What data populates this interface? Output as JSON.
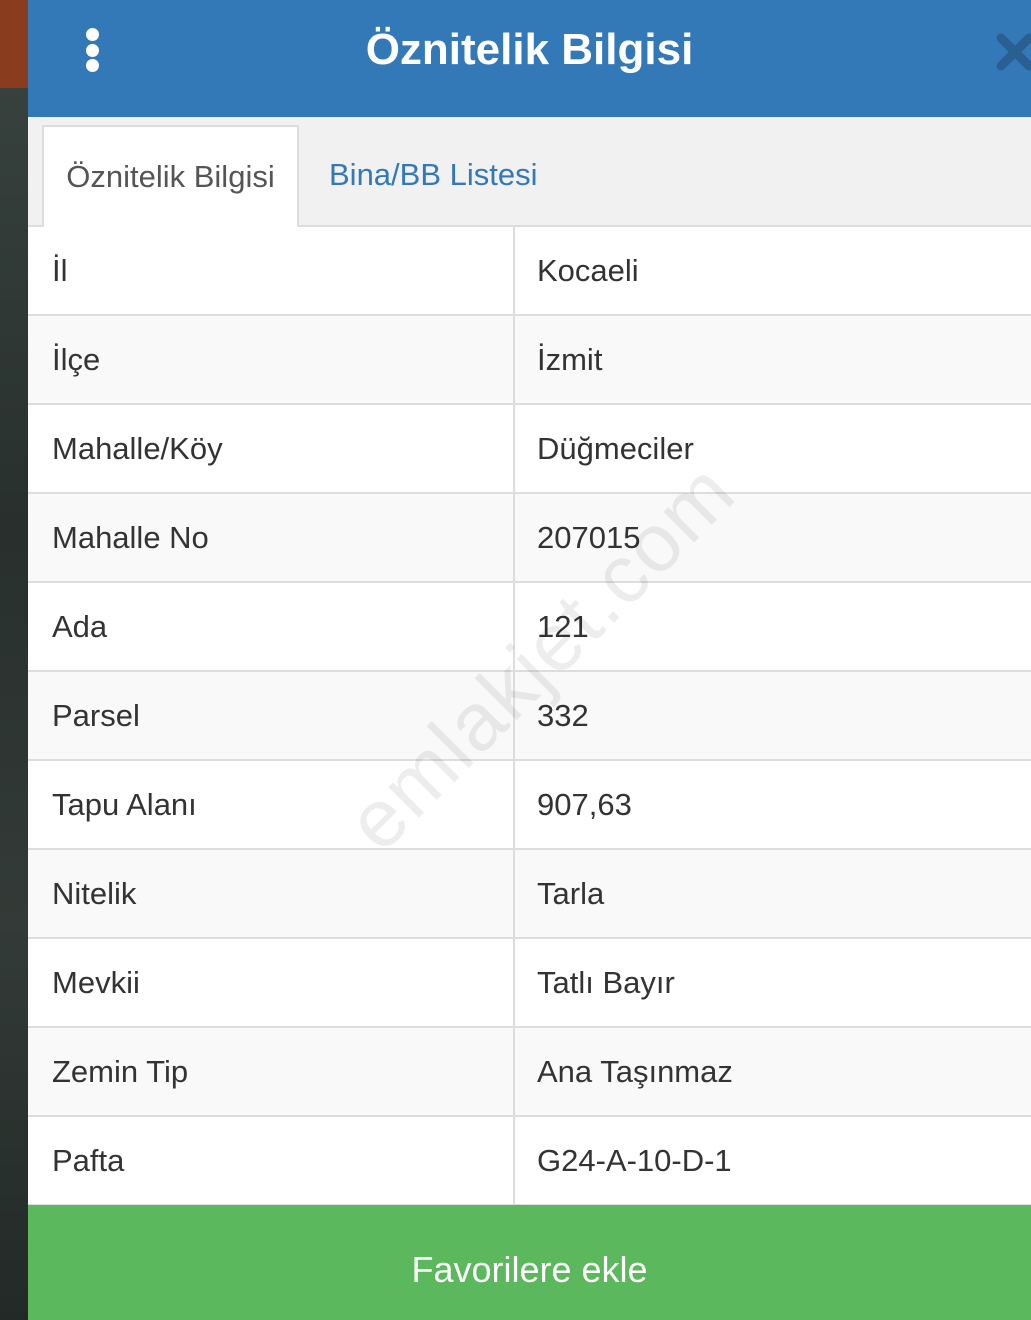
{
  "header": {
    "title": "Öznitelik Bilgisi",
    "menu_icon": "vertical-ellipsis-icon",
    "close_icon": "close-x-icon"
  },
  "tabs": [
    {
      "label": "Öznitelik Bilgisi",
      "active": true
    },
    {
      "label": "Bina/BB Listesi",
      "active": false
    }
  ],
  "attributes": [
    {
      "key": "İl",
      "value": "Kocaeli"
    },
    {
      "key": "İlçe",
      "value": "İzmit"
    },
    {
      "key": "Mahalle/Köy",
      "value": "Düğmeciler"
    },
    {
      "key": "Mahalle No",
      "value": "207015"
    },
    {
      "key": "Ada",
      "value": "121"
    },
    {
      "key": "Parsel",
      "value": "332"
    },
    {
      "key": "Tapu Alanı",
      "value": "907,63"
    },
    {
      "key": "Nitelik",
      "value": "Tarla"
    },
    {
      "key": "Mevkii",
      "value": "Tatlı Bayır"
    },
    {
      "key": "Zemin Tip",
      "value": "Ana Taşınmaz"
    },
    {
      "key": "Pafta",
      "value": "G24-A-10-D-1"
    }
  ],
  "watermark": "emlakjet.com",
  "footer": {
    "favorite_label": "Favorilere ekle"
  },
  "colors": {
    "header_bg": "#3379b7",
    "tab_link": "#3379b7",
    "favorite_bg": "#5cb85c"
  }
}
